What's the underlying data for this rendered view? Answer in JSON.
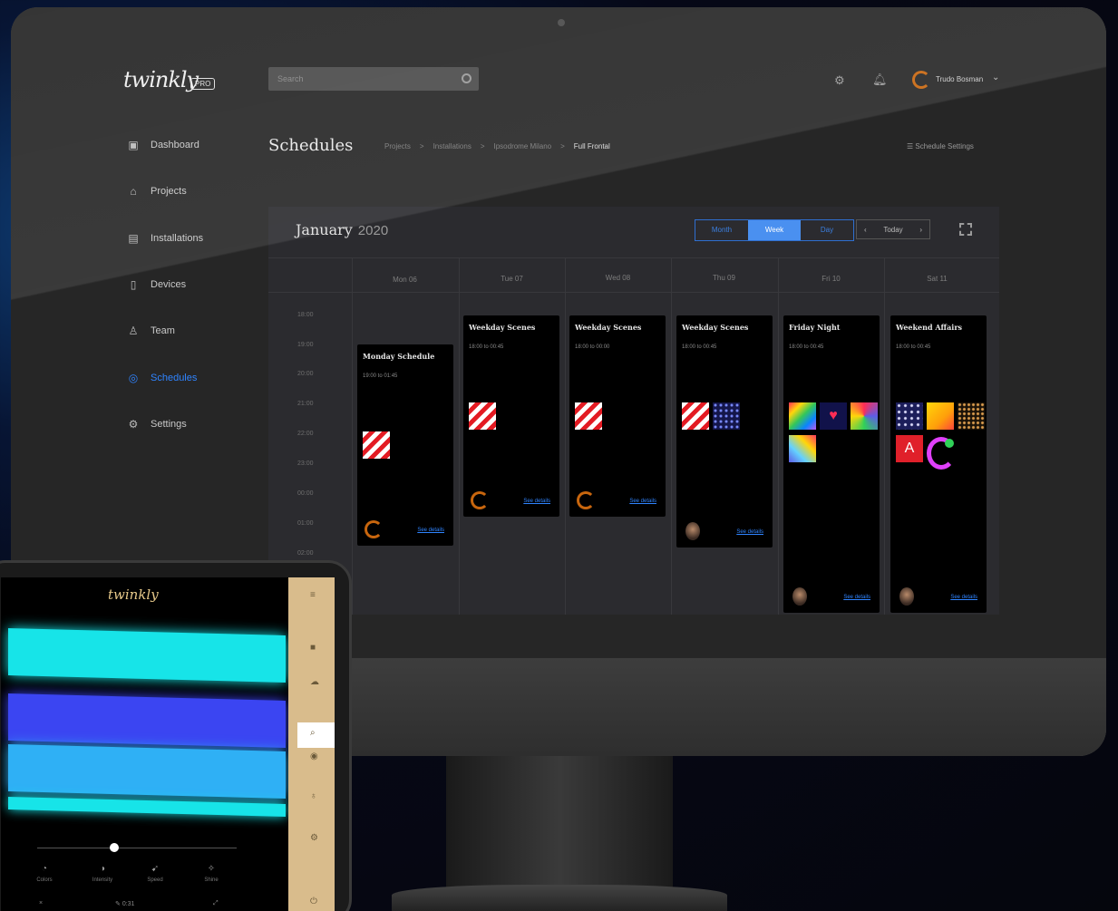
{
  "app": {
    "logo": "twinkly",
    "pro_badge": "PRO",
    "search_placeholder": "Search",
    "user_name": "Trudo Bosman"
  },
  "sidebar": {
    "items": [
      {
        "label": "Dashboard",
        "icon": "dashboard-icon",
        "glyph": "▣"
      },
      {
        "label": "Projects",
        "icon": "projects-icon",
        "glyph": "⌂"
      },
      {
        "label": "Installations",
        "icon": "installations-icon",
        "glyph": "▤"
      },
      {
        "label": "Devices",
        "icon": "devices-icon",
        "glyph": "▯"
      },
      {
        "label": "Team",
        "icon": "team-icon",
        "glyph": "♙"
      },
      {
        "label": "Schedules",
        "icon": "schedules-icon",
        "glyph": "◎"
      },
      {
        "label": "Settings",
        "icon": "settings-icon",
        "glyph": "⚙"
      }
    ],
    "active": "Schedules"
  },
  "page": {
    "title": "Schedules",
    "breadcrumb": [
      "Projects",
      "Installations",
      "Ipsodrome Milano",
      "Full Frontal"
    ],
    "schedule_settings": "Schedule Settings"
  },
  "calendar": {
    "month": "January",
    "year": "2020",
    "views": [
      "Month",
      "Week",
      "Day"
    ],
    "active_view": "Week",
    "today_label": "Today",
    "days": [
      "Mon 06",
      "Tue 07",
      "Wed 08",
      "Thu 09",
      "Fri 10",
      "Sat 11"
    ],
    "times": [
      "18:00",
      "19:00",
      "20:00",
      "21:00",
      "22:00",
      "23:00",
      "00:00",
      "01:00",
      "02:00"
    ],
    "events": [
      {
        "title": "Monday Schedule",
        "time": "19:00 to 01:45",
        "link": "See details"
      },
      {
        "title": "Weekday Scenes",
        "time": "18:00 to 00:45",
        "link": "See details"
      },
      {
        "title": "Weekday Scenes",
        "time": "18:00 to 00:00",
        "link": "See details"
      },
      {
        "title": "Weekday Scenes",
        "time": "18:00 to 00:45",
        "link": "See details"
      },
      {
        "title": "Friday Night",
        "time": "18:00 to 00:45",
        "link": "See details"
      },
      {
        "title": "Weekend Affairs",
        "time": "18:00 to 00:45",
        "link": "See details"
      }
    ]
  },
  "tablet": {
    "logo": "twinkly",
    "controls": [
      "Colors",
      "Intensity",
      "Speed",
      "Shine"
    ],
    "bottom_value": "0:31"
  },
  "colors": {
    "accent": "#2f84ff",
    "highlight_orange": "#c8660e",
    "tablet_sidebar": "#d9bc8c",
    "led_cyan": "#17e4e8",
    "led_blue": "#3b45f2",
    "led_sky": "#2fb0f5"
  }
}
